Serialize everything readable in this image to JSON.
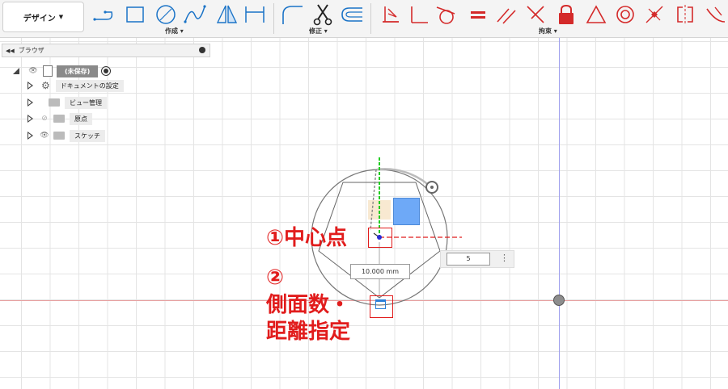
{
  "toolbar": {
    "design_label": "デザイン",
    "groups": {
      "create": "作成",
      "modify": "修正",
      "constraints": "拘束"
    }
  },
  "browser": {
    "title": "ブラウザ",
    "items": [
      {
        "label": "(未保存)"
      },
      {
        "label": "ドキュメントの設定"
      },
      {
        "label": "ビュー管理"
      },
      {
        "label": "原点"
      },
      {
        "label": "スケッチ"
      }
    ]
  },
  "canvas": {
    "dimension_value": "10.000 mm",
    "sides_input_value": "5"
  },
  "annotations": {
    "one": "①中心点",
    "two_num": "②",
    "two_line1": "側面数・",
    "two_line2": "距離指定"
  },
  "colors": {
    "annotation_red": "#e11c1c",
    "axis_green": "#22cc22",
    "axis_red": "#e8a0a0",
    "axis_blue": "#9fa0ee",
    "view_cube_blue": "#6ea9f7"
  }
}
